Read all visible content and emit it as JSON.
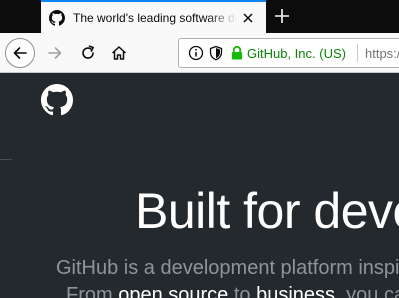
{
  "browser": {
    "tab": {
      "title": "The world's leading software development platform · GitHub",
      "favicon": "github-octocat-icon",
      "close_icon": "close-icon"
    },
    "new_tab_icon": "plus-icon",
    "nav": {
      "back_icon": "arrow-left-icon",
      "forward_icon": "arrow-right-icon",
      "reload_icon": "reload-icon",
      "home_icon": "home-icon"
    },
    "urlbar": {
      "info_icon": "info-icon",
      "tracking_icon": "shield-icon",
      "lock_icon": "lock-icon",
      "identity": "GitHub, Inc. (US)",
      "url": "https://github.com/"
    }
  },
  "page": {
    "logo": "github-octocat-icon",
    "hero": {
      "title": "Built for developers",
      "line1": "GitHub is a development platform inspired by the way you work.",
      "line2_parts": [
        "From ",
        "open source",
        " to ",
        "business",
        ", you can host and review code"
      ]
    }
  },
  "colors": {
    "tab_accent": "#0a84ff",
    "identity_green": "#058b00",
    "page_background": "#24292e",
    "hero_subtext": "#8c949c"
  }
}
